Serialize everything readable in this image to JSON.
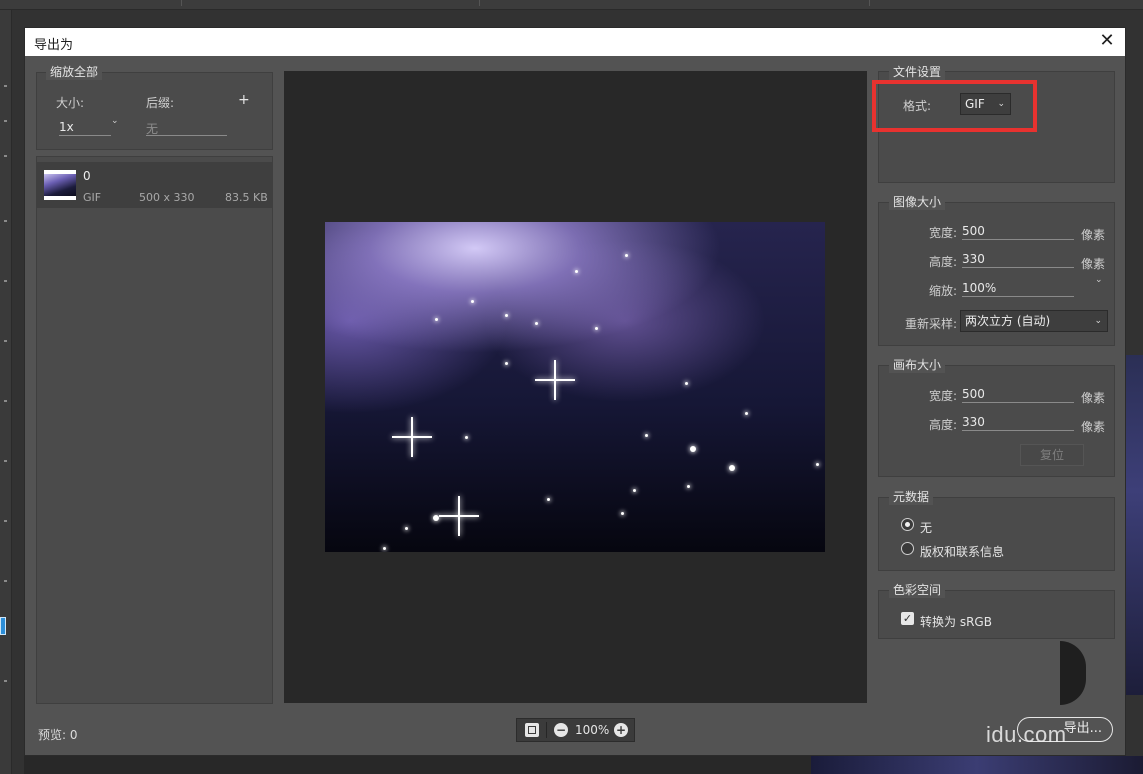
{
  "window": {
    "title": "导出为",
    "close_glyph": "✕"
  },
  "left_panel": {
    "group_title": "缩放全部",
    "size_label": "大小:",
    "size_value": "1x",
    "suffix_label": "后缀:",
    "suffix_placeholder": "无",
    "add_glyph": "+",
    "asset": {
      "name": "0",
      "format": "GIF",
      "dimensions": "500 x 330",
      "filesize": "83.5 KB"
    }
  },
  "preview": {
    "label": "预览: 0",
    "zoom": "100%",
    "zoom_out": "−",
    "zoom_in": "+"
  },
  "file_settings": {
    "title": "文件设置",
    "format_label": "格式:",
    "format_value": "GIF"
  },
  "image_size": {
    "title": "图像大小",
    "width_label": "宽度:",
    "width_value": "500",
    "height_label": "高度:",
    "height_value": "330",
    "scale_label": "缩放:",
    "scale_value": "100%",
    "resample_label": "重新采样:",
    "resample_value": "两次立方 (自动)",
    "unit": "像素"
  },
  "canvas_size": {
    "title": "画布大小",
    "width_label": "宽度:",
    "width_value": "500",
    "height_label": "高度:",
    "height_value": "330",
    "unit": "像素",
    "reset_label": "复位"
  },
  "metadata": {
    "title": "元数据",
    "option_none": "无",
    "option_copyright": "版权和联系信息",
    "selected": "无"
  },
  "color_space": {
    "title": "色彩空间",
    "convert_label": "转换为 sRGB",
    "checked": true
  },
  "footer": {
    "export_label": "导出...",
    "watermark": "idu.com"
  },
  "colors": {
    "highlight": "#e8322f",
    "dialog_bg": "#535353",
    "preview_bg": "#282828"
  }
}
